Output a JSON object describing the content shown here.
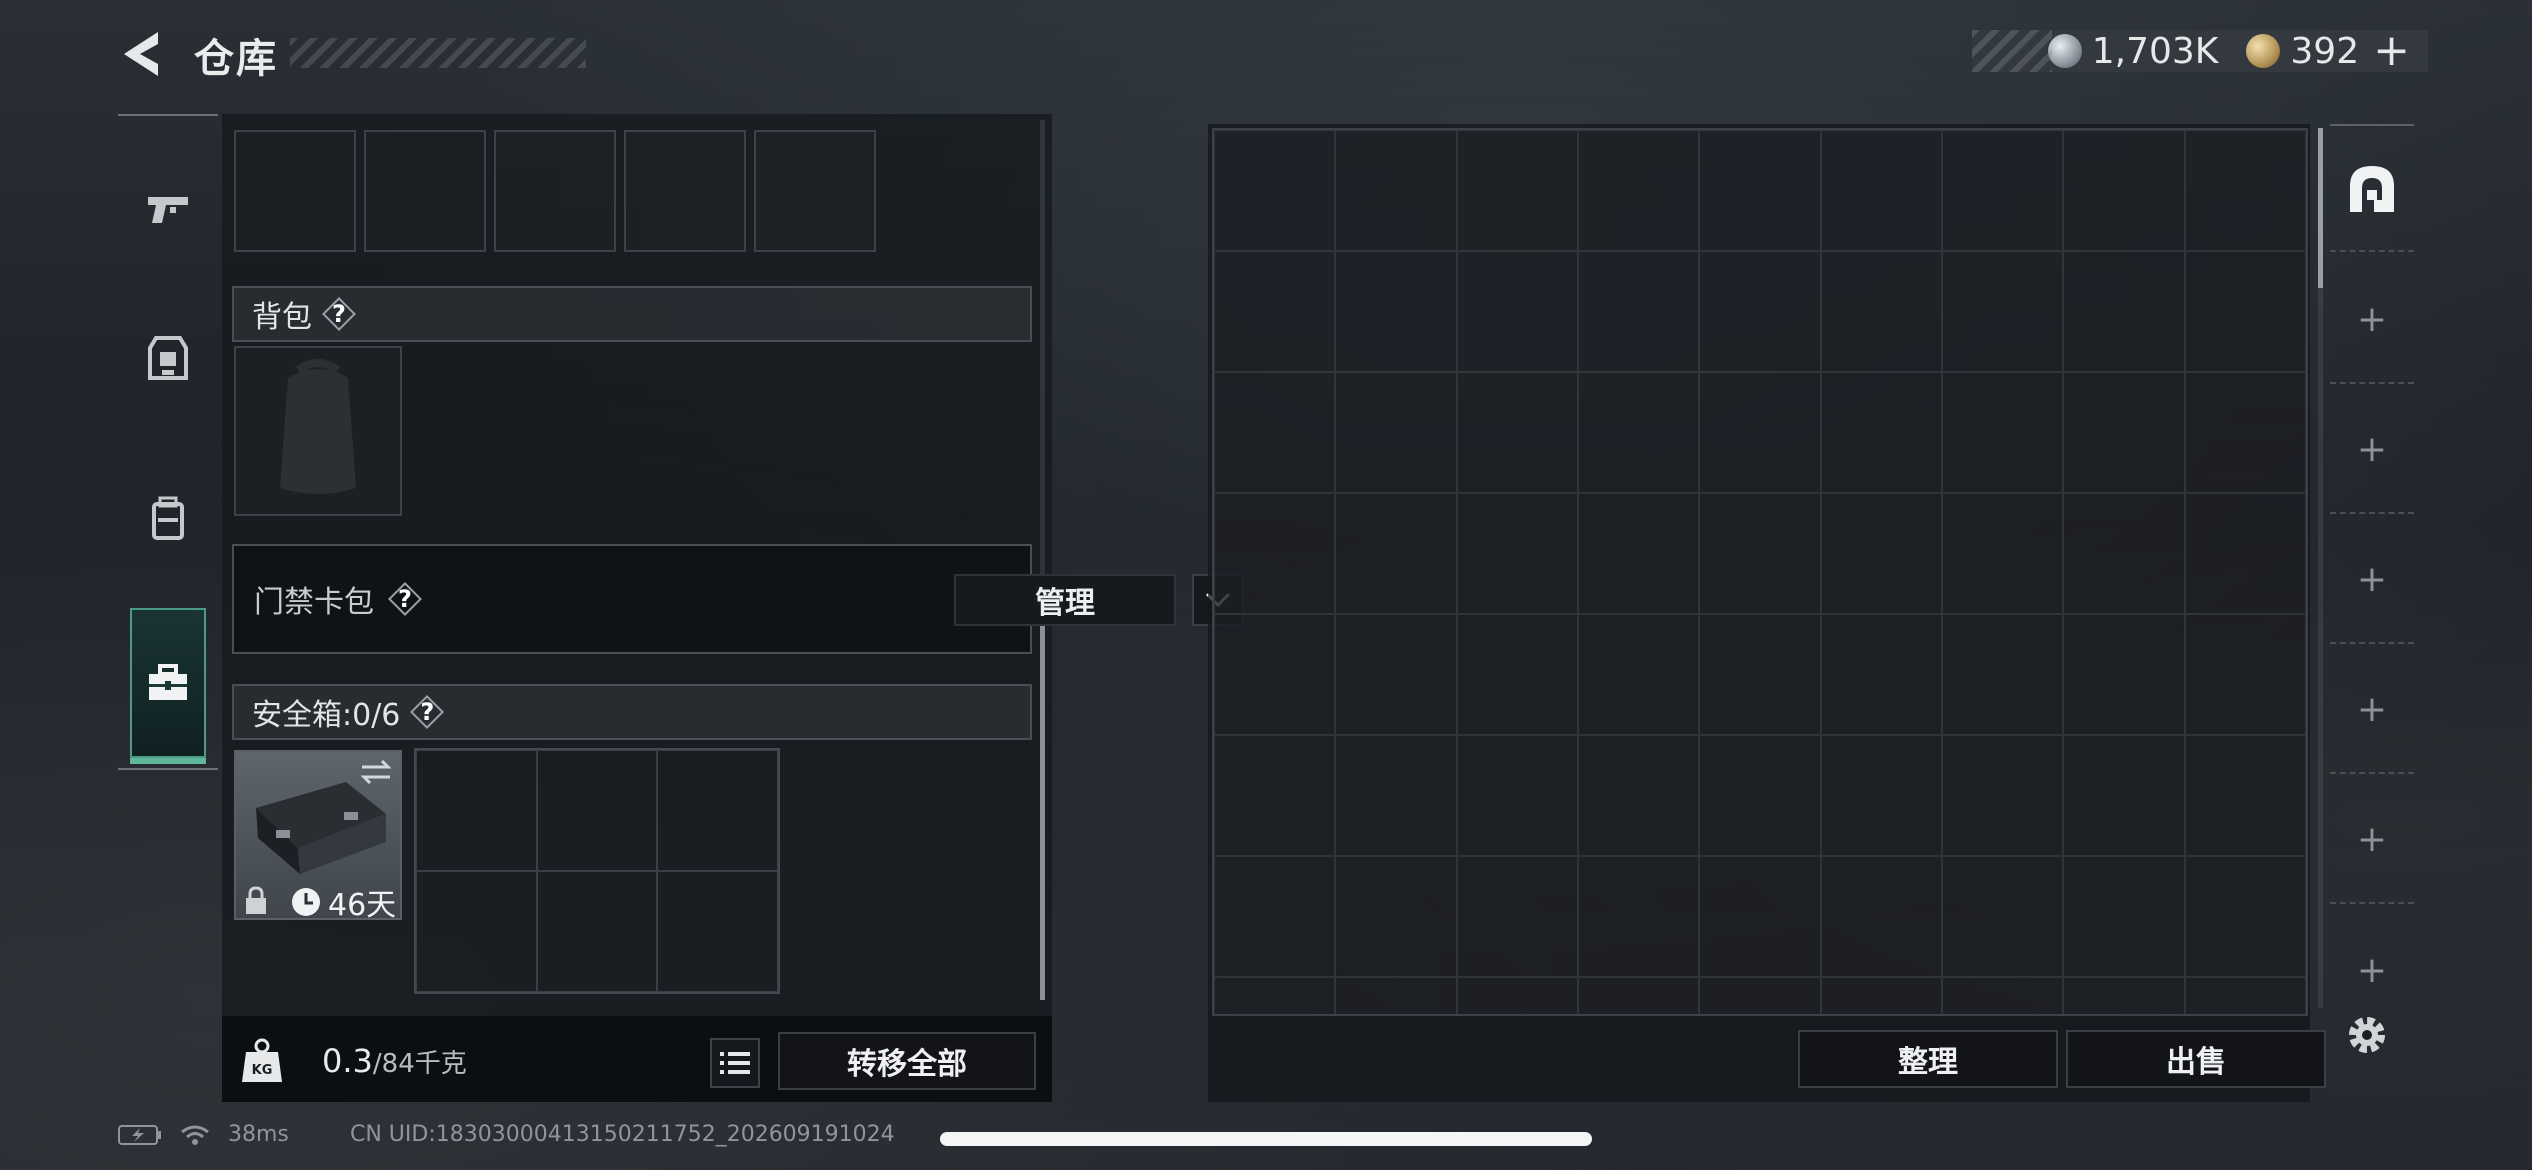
{
  "header": {
    "title": "仓库",
    "currency": [
      {
        "icon": "silver-coin-icon",
        "value": "1,703K"
      },
      {
        "icon": "gold-coin-icon",
        "value": "392"
      }
    ],
    "add_label": "+"
  },
  "left_rail": {
    "items": [
      {
        "icon": "pistol-icon",
        "active": false
      },
      {
        "icon": "armor-vest-icon",
        "active": false
      },
      {
        "icon": "backpack-icon",
        "active": false
      },
      {
        "icon": "toolbox-icon",
        "active": true
      }
    ]
  },
  "loadout": {
    "backpack_label": "背包",
    "keycard_label": "门禁卡包",
    "manage_label": "管理",
    "safebox_label": "安全箱:0/6",
    "safebox_timer": "46天",
    "help_label": "?"
  },
  "footer_left": {
    "weight_current": "0.3",
    "weight_max": "/84千克",
    "transfer_all_label": "转移全部"
  },
  "footer_right": {
    "sort_label": "整理",
    "sell_label": "出售"
  },
  "status": {
    "ping": "38ms",
    "uid": "CN UID:18303000413150211752_202609191024"
  },
  "colors": {
    "accent": "#4e9b85",
    "accent_bright": "#5fb89b",
    "panel": "#16191e"
  }
}
